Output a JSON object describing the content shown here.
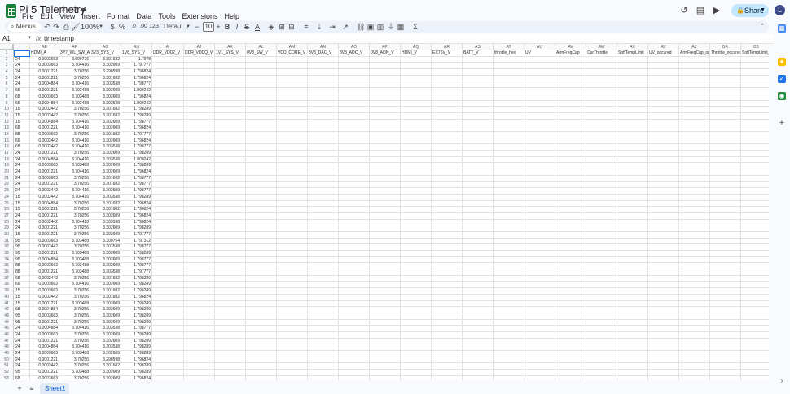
{
  "doc": {
    "title": "Pi 5 Telemetry",
    "menus": [
      "File",
      "Edit",
      "View",
      "Insert",
      "Format",
      "Data",
      "Tools",
      "Extensions",
      "Help"
    ],
    "share_label": "Share",
    "avatar_initial": "L"
  },
  "toolbar": {
    "menus_search": "Menus",
    "zoom": "100%",
    "currency": "$",
    "percent": "%",
    "dec_less": ".0",
    "dec_more": ".00",
    "number_format": "123",
    "font": "Defaul...",
    "font_size": "10",
    "minus": "−",
    "plus": "+",
    "bold": "B",
    "italic": "I",
    "strike": "S",
    "text_color": "A"
  },
  "formula_bar": {
    "cell_ref": "A1",
    "fx": "fx",
    "value": "timestamp"
  },
  "grid": {
    "columns": [
      "AE",
      "AF",
      "AG",
      "AH",
      "AI",
      "AJ",
      "AK",
      "AL",
      "AM",
      "AN",
      "AO",
      "AP",
      "AQ",
      "AR",
      "AS",
      "AT",
      "AU",
      "AV",
      "AW",
      "AX",
      "AY",
      "AZ",
      "BA",
      "BB"
    ],
    "header_row": [
      "HDMI_A",
      "3V7_WL_SW_A",
      "3V3_SYS_V",
      "1V8_SYS_V",
      "DDR_VDD2_V",
      "DDR_VDDQ_V",
      "1V1_SYS_V",
      "0V8_SW_V",
      "VDD_CORE_V",
      "3V3_DAC_V",
      "3V3_ADC_V",
      "0V8_AON_V",
      "HDMI_V",
      "EXT5V_V",
      "BATT_V",
      "throttle_hex",
      "UV",
      "ArmFreqCap",
      "CurThrottle",
      "SoftTempLimit",
      "UV_occured",
      "ArmFreqCap_oc",
      "Throttle_occured",
      "SoftTempLimit_oc"
    ],
    "row_count": 55,
    "prefixes": [
      "'24",
      "'24",
      "'24",
      "'24",
      "'24",
      "'66",
      "'68",
      "'66",
      "'15",
      "'15",
      "'15",
      "'68",
      "'88",
      "'66",
      "'68",
      "'24",
      "'24",
      "'24",
      "'24",
      "'24",
      "'24",
      "'24",
      "'15",
      "'15",
      "'15",
      "'24",
      "'24",
      "'24",
      "'15",
      "'95",
      "'95",
      "'95",
      "'95",
      "'88",
      "'88",
      "'68",
      "'66",
      "'15",
      "'15",
      "'15",
      "'68",
      "'95",
      "'95",
      "'24",
      "'24",
      "'24",
      "'24",
      "'24",
      "'24",
      "'24",
      "'95",
      "'68",
      "'68",
      "'66"
    ],
    "col_a": [
      "0.0003663",
      "0.0003663",
      "0.0001221",
      "0.0001221",
      "0.0004884",
      "0.0001221",
      "0.0003663",
      "0.0004884",
      "0.0002442",
      "0.0002442",
      "0.0004884",
      "0.0001221",
      "0.0003663",
      "0.0002442",
      "0.0002442",
      "0.0001221",
      "0.0004884",
      "0.0003663",
      "0.0001221",
      "0.0003663",
      "0.0001221",
      "0.0002442",
      "0.0002442",
      "0.0004884",
      "0.0001221",
      "0.0001221",
      "0.0002442",
      "0.0001221",
      "0.0001221",
      "0.0003663",
      "0.0002442",
      "0.0001221",
      "0.0004884",
      "0.0003663",
      "0.0001221",
      "0.0002442",
      "0.0003663",
      "0.0003663",
      "0.0002442",
      "0.0001221",
      "0.0004884",
      "0.0003663",
      "0.0001221",
      "0.0004884",
      "0.0003663",
      "0.0001221",
      "0.0004884",
      "0.0003663",
      "0.0001221",
      "0.0002442",
      "0.0001221",
      "0.0003663",
      "0.0001221",
      "0.0002442"
    ],
    "col_b": [
      "3.699776",
      "3.704416",
      "3.70256",
      "3.70256",
      "3.704416",
      "3.703488",
      "3.703488",
      "3.703488",
      "3.70256",
      "3.70256",
      "3.704416",
      "3.704416",
      "3.70256",
      "3.704416",
      "3.704416",
      "3.70256",
      "3.704416",
      "3.703488",
      "3.704416",
      "3.70256",
      "3.70256",
      "3.704416",
      "3.704416",
      "3.70256",
      "3.70256",
      "3.70256",
      "3.704416",
      "3.70256",
      "3.70256",
      "3.703488",
      "3.70256",
      "3.703488",
      "3.703488",
      "3.703488",
      "3.703488",
      "3.70256",
      "3.704416",
      "3.70256",
      "3.70256",
      "3.703488",
      "3.70256",
      "3.70256",
      "3.70256",
      "3.704416",
      "3.70256",
      "3.70256",
      "3.704416",
      "3.703488",
      "3.70256",
      "3.70256",
      "3.703488",
      "3.70256",
      "3.703488",
      "3.70256"
    ],
    "col_c": [
      "3.301682",
      "3.302609",
      "3.298598",
      "3.301682",
      "3.303538",
      "3.302609",
      "3.302609",
      "3.303538",
      "3.301682",
      "3.301682",
      "3.302609",
      "3.302609",
      "3.301682",
      "3.302609",
      "3.303538",
      "3.302609",
      "3.303538",
      "3.302609",
      "3.302609",
      "3.301682",
      "3.301682",
      "3.302609",
      "3.303538",
      "3.301682",
      "3.301682",
      "3.302609",
      "3.303538",
      "3.302609",
      "3.302609",
      "3.300754",
      "3.303538",
      "3.302609",
      "3.302609",
      "3.302609",
      "3.303538",
      "3.301682",
      "3.302609",
      "3.301682",
      "3.301682",
      "3.302609",
      "3.302609",
      "3.302609",
      "3.302609",
      "3.303538",
      "3.302609",
      "3.302609",
      "3.303538",
      "3.302609",
      "3.298598",
      "3.301682",
      "3.302609",
      "3.302609",
      "3.303538",
      "3.301682"
    ],
    "col_d": [
      "1.7978",
      "1.797777",
      "1.796824",
      "1.796824",
      "1.798777",
      "1.800242",
      "1.796824",
      "1.800242",
      "1.798289",
      "1.798289",
      "1.798777",
      "1.796824",
      "1.797777",
      "1.796824",
      "1.798777",
      "1.798289",
      "1.800242",
      "1.798289",
      "1.796824",
      "1.798777",
      "1.798777",
      "1.798777",
      "1.798289",
      "1.796824",
      "1.796824",
      "1.796824",
      "1.796824",
      "1.798289",
      "1.797777",
      "1.797312",
      "1.798777",
      "1.798289",
      "1.798777",
      "1.798777",
      "1.797777",
      "1.798289",
      "1.798289",
      "1.798289",
      "1.796824",
      "1.798289",
      "1.798289",
      "1.798289",
      "1.798289",
      "1.798777",
      "1.798289",
      "1.798289",
      "1.798289",
      "1.798289",
      "1.796824",
      "1.798289",
      "1.798289",
      "1.796824",
      "1.797777",
      "1.796824"
    ]
  }
}
